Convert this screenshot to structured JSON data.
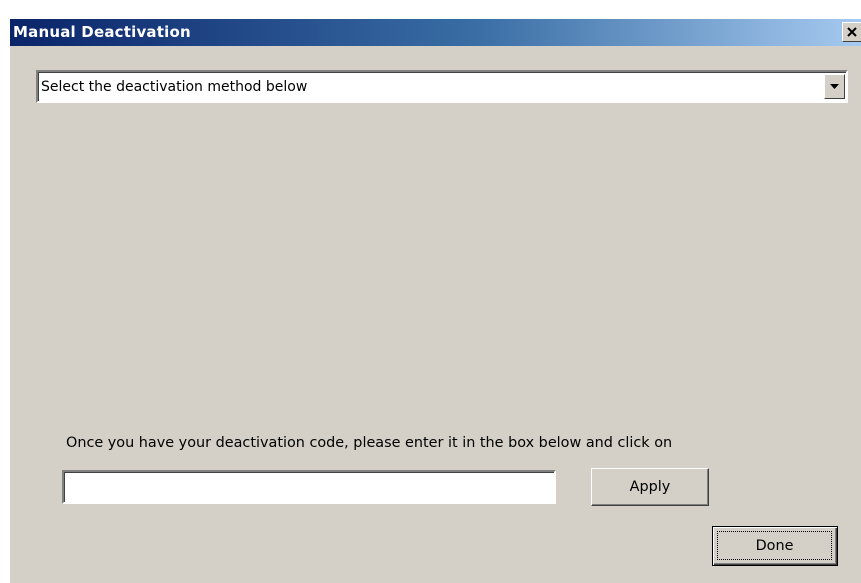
{
  "window": {
    "title": "Manual Deactivation"
  },
  "method_select": {
    "selected_value": "Select the deactivation method below"
  },
  "code_entry": {
    "instruction": "Once you have your deactivation code, please enter it in the box below and click on",
    "value": "",
    "apply_label": "Apply"
  },
  "footer": {
    "done_label": "Done"
  },
  "icons": {
    "close": "close-icon",
    "dropdown": "chevron-down-icon"
  },
  "colors": {
    "titlebar_start": "#0a246a",
    "titlebar_end": "#a6caf0",
    "dialog_background": "#d4d0c8"
  }
}
